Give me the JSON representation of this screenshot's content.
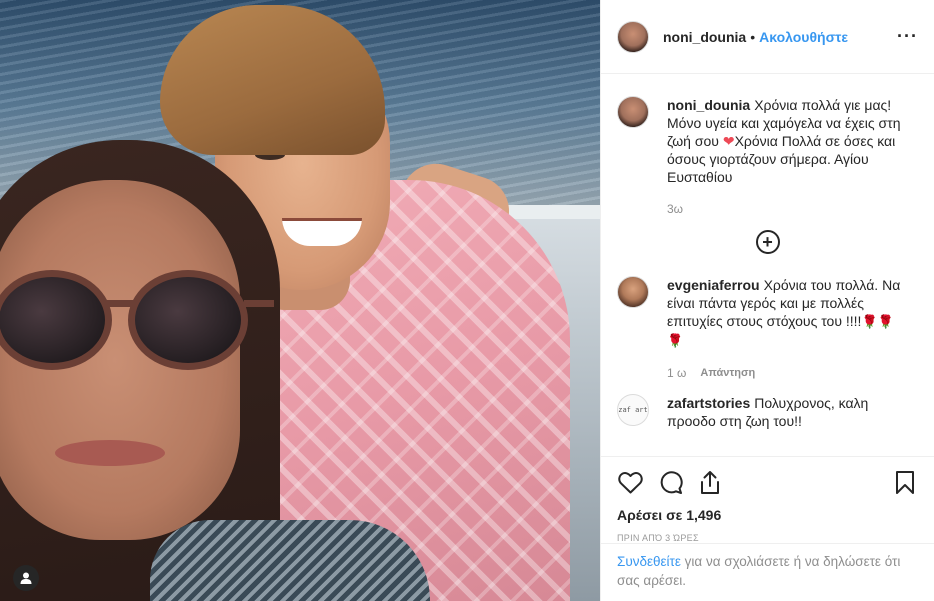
{
  "header": {
    "username": "noni_dounia",
    "separator": "•",
    "follow_label": "Ακολουθήστε",
    "more_label": "···"
  },
  "caption": {
    "username": "noni_dounia",
    "text_part1": "Χρόνια πολλά γιε μας! Μόνο υγεία και χαμόγελα να έχεις στη ζωή σου",
    "heart_emoji": "❤",
    "text_part2": "Χρόνια Πολλά σε όσες και όσους γιορτάζουν σήμερα. Αγίου Ευσταθίου",
    "age": "3ω"
  },
  "load_more_label": "+",
  "comments": [
    {
      "username": "evgeniaferrou",
      "text": "Χρόνια του πολλά. Να είναι πάντα γερός και με πολλές επιτυχίες στους στόχους του !!!!",
      "emoji": "🌹🌹",
      "emoji2": "🌹",
      "age": "1 ω",
      "reply_label": "Απάντηση"
    },
    {
      "username": "zafartstories",
      "avatar_text": "zaf art",
      "text": "Πολυχρονος, καλη προοδο στη ζωη του!!"
    }
  ],
  "likes_label": "Αρέσει σε 1,496",
  "timestamp": "ΠΡΙΝ ΑΠΌ 3 ΏΡΕΣ",
  "login": {
    "link_text": "Συνδεθείτε",
    "rest_text": " για να σχολιάσετε ή να δηλώσετε ότι σας αρέσει."
  },
  "colors": {
    "accent": "#3897f0",
    "text": "#262626",
    "muted": "#8e8e8e",
    "border": "#efefef"
  },
  "icons": [
    "heart-icon",
    "comment-icon",
    "share-icon",
    "bookmark-icon",
    "more-options-icon",
    "user-tag-icon",
    "plus-circle-icon"
  ]
}
